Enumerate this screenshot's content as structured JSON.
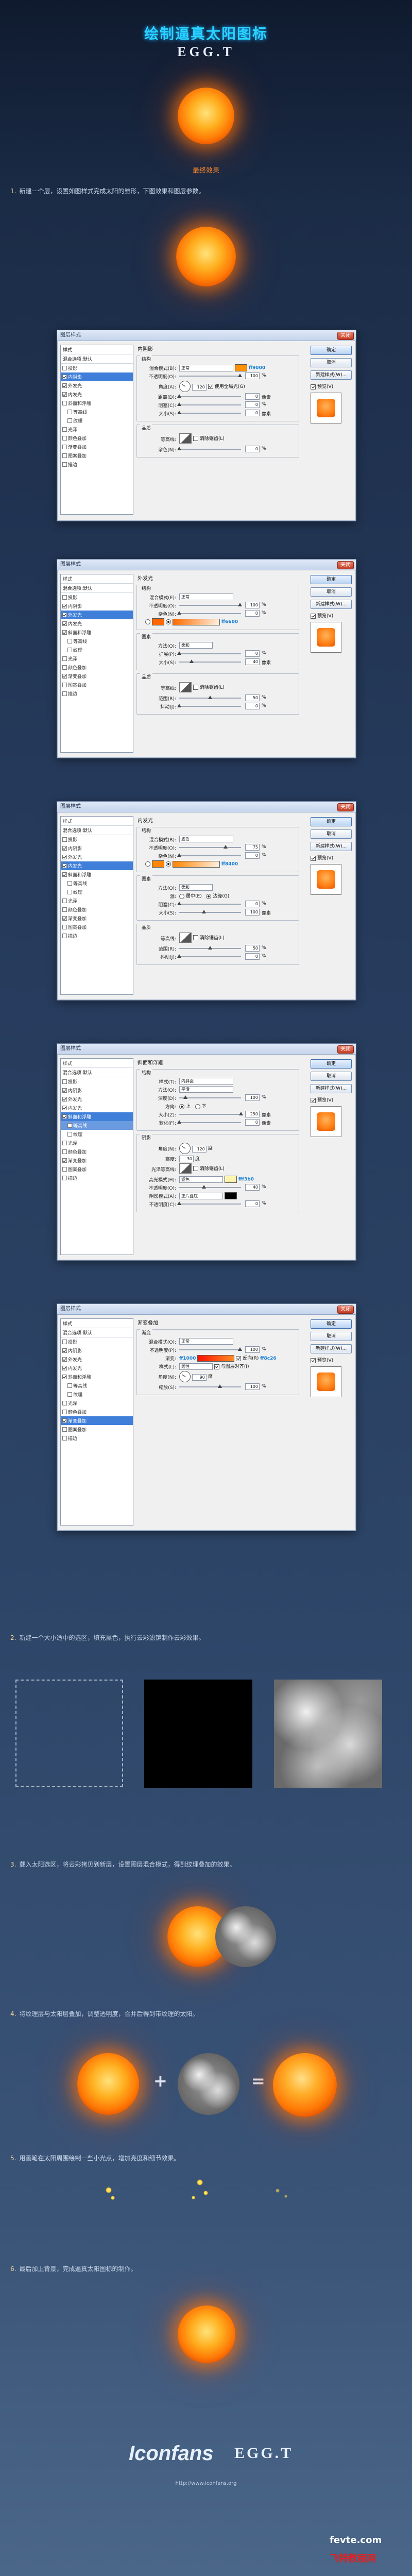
{
  "header": {
    "title": "绘制逼真太阳图标",
    "brand": "EGG.T"
  },
  "hero": {
    "caption": "最终效果"
  },
  "steps": [
    {
      "num": "1.",
      "text": "新建一个层，设置如图样式完成太阳的雏形，下图效果和图层参数。"
    },
    {
      "num": "2.",
      "text": "新建一个大小适中的选区，填充黑色，执行云彩滤镜制作云彩效果。"
    },
    {
      "num": "3.",
      "text": "载入太阳选区，将云彩拷贝到新层，设置图层混合模式，得到纹理叠加的效果。"
    },
    {
      "num": "4.",
      "text": "将纹理层与太阳层叠加，调整透明度，合并后得到带纹理的太阳。"
    },
    {
      "num": "5.",
      "text": "用画笔在太阳周围绘制一些小光点，增加亮度和细节效果。"
    },
    {
      "num": "6.",
      "text": "最后加上背景，完成逼真太阳图标的制作。"
    }
  ],
  "dialog_common": {
    "title": "图层样式",
    "close": "关闭",
    "ok": "确定",
    "cancel": "取消",
    "new_style": "新建样式(W)...",
    "preview": "预览(V)",
    "styles_header": "样式",
    "blend_opts": "混合选项:默认"
  },
  "dialog1": {
    "items": [
      "投影",
      "内阴影",
      "外发光",
      "内发光",
      "斜面和浮雕",
      "等高线",
      "纹理",
      "光泽",
      "颜色叠加",
      "渐变叠加",
      "图案叠加",
      "描边"
    ],
    "checked": [
      false,
      false,
      true,
      true,
      false,
      false,
      false,
      false,
      false,
      false,
      false,
      false
    ],
    "selected": 3,
    "section": "内阴影",
    "struct": "结构",
    "blend_label": "混合模式(B):",
    "blend_val": "正常",
    "color_hex": "ff9000",
    "opacity_label": "不透明度(O):",
    "opacity_val": "100",
    "angle_label": "角度(A):",
    "angle_val": "120",
    "global_light": "使用全局光(G)",
    "distance_label": "距离(D):",
    "distance_val": "0",
    "choke_label": "阻塞(C):",
    "choke_val": "0",
    "size_label": "大小(S):",
    "size_val": "0",
    "quality": "品质",
    "contour_label": "等高线:",
    "anti_alias": "消除锯齿(L)",
    "noise_label": "杂色(N):",
    "noise_val": "0"
  },
  "dialog2": {
    "selected": 2,
    "section": "外发光",
    "struct": "结构",
    "blend_label": "混合模式(E):",
    "blend_val": "正常",
    "opacity_label": "不透明度(O):",
    "opacity_val": "100",
    "noise_label": "杂色(N):",
    "noise_val": "0",
    "grad_hex": "ff6600",
    "elements": "图素",
    "method_label": "方法(Q):",
    "method_val": "柔和",
    "spread_label": "扩展(P):",
    "spread_val": "0",
    "size_label": "大小(S):",
    "size_val": "40",
    "quality": "品质",
    "contour_label": "等高线:",
    "anti_alias": "消除锯齿(L)",
    "range_label": "范围(R):",
    "range_val": "50",
    "jitter_label": "抖动(J):",
    "jitter_val": "0"
  },
  "dialog3": {
    "selected": 3,
    "section": "内发光",
    "struct": "结构",
    "blend_label": "混合模式(B):",
    "blend_val": "滤色",
    "opacity_label": "不透明度(O):",
    "opacity_val": "75",
    "noise_label": "杂色(N):",
    "noise_val": "0",
    "grad_hex": "ff8400",
    "elements": "图素",
    "method_label": "方法(Q):",
    "method_val": "柔和",
    "source_label": "源:",
    "source_center": "居中(E)",
    "source_edge": "边缘(G)",
    "choke_label": "阻塞(C):",
    "choke_val": "0",
    "size_label": "大小(S):",
    "size_val": "100",
    "quality": "品质",
    "contour_label": "等高线:",
    "anti_alias": "消除锯齿(L)",
    "range_label": "范围(R):",
    "range_val": "50",
    "jitter_label": "抖动(J):",
    "jitter_val": "0"
  },
  "dialog4": {
    "selected": 4,
    "section": "斜面和浮雕",
    "struct": "结构",
    "style_label": "样式(T):",
    "style_val": "内斜面",
    "tech_label": "方法(Q):",
    "tech_val": "平滑",
    "depth_label": "深度(D):",
    "depth_val": "100",
    "dir_label": "方向:",
    "dir_up": "上",
    "dir_down": "下",
    "size_label": "大小(Z):",
    "size_val": "250",
    "soften_label": "软化(F):",
    "soften_val": "0",
    "shading": "阴影",
    "angle_label": "角度(N):",
    "angle_val": "120",
    "alt_label": "高度:",
    "alt_val": "30",
    "gloss_label": "光泽等高线:",
    "anti_alias": "消除锯齿(L)",
    "hl_label": "高光模式(H):",
    "hl_val": "滤色",
    "hl_hex": "fff3b0",
    "hl_op_label": "不透明度(O):",
    "hl_op_val": "40",
    "sh_label": "阴影模式(A):",
    "sh_val": "正片叠底",
    "sh_op_label": "不透明度(C):",
    "sh_op_val": "0"
  },
  "dialog5": {
    "selected": 10,
    "section": "渐变叠加",
    "sub": "渐变",
    "blend_label": "混合模式(O):",
    "blend_val": "正常",
    "opacity_label": "不透明度(P):",
    "opacity_val": "100",
    "grad_label": "渐变:",
    "grad_left": "ff1000",
    "grad_right": "ff8c26",
    "reverse": "反向(R)",
    "style_label": "样式(L):",
    "style_val": "线性",
    "align": "与图层对齐(I)",
    "angle_label": "角度(N):",
    "angle_val": "90",
    "scale_label": "缩放(S):",
    "scale_val": "100"
  },
  "footer": {
    "logo": "Iconfans",
    "brand": "EGG.T",
    "url": "http://www.iconfans.org",
    "wm1": "fevte.com",
    "wm2": "飞特教程网"
  },
  "colors": {
    "accent": "#ff8a2a",
    "brand_blue": "#2ad3ff"
  }
}
